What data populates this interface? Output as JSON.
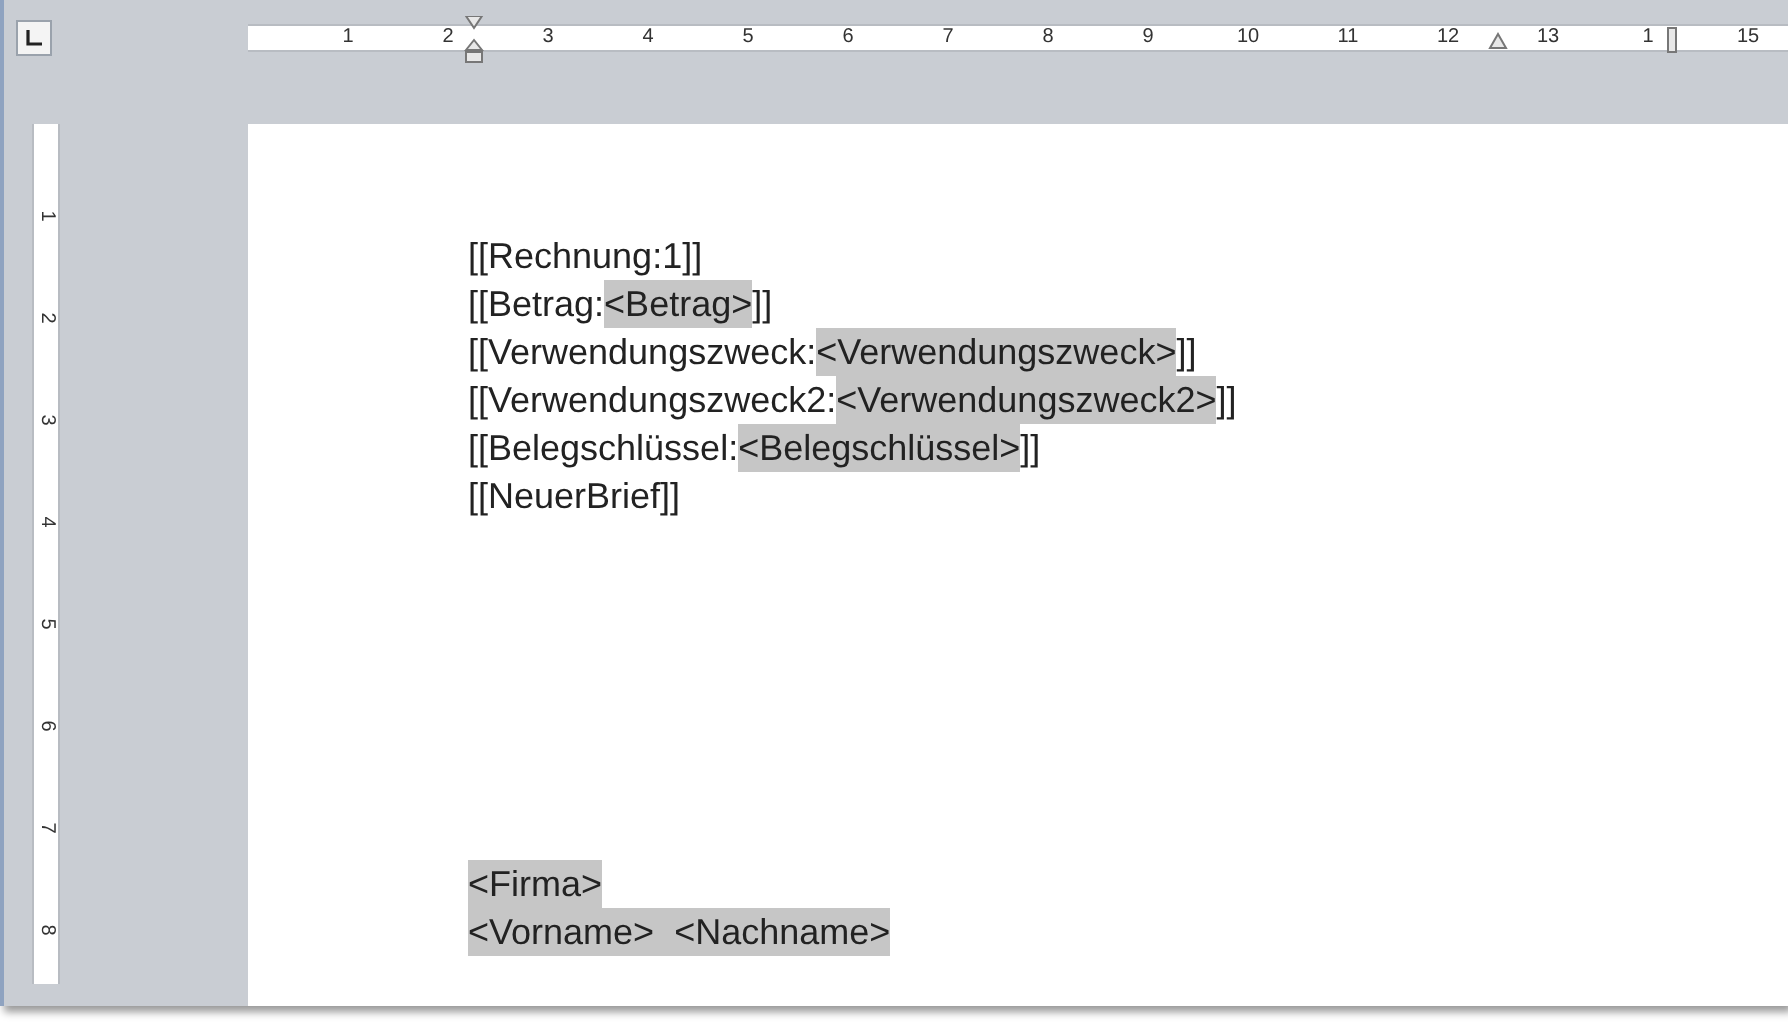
{
  "ruler": {
    "horizontal": [
      "1",
      "2",
      "3",
      "4",
      "5",
      "6",
      "7",
      "8",
      "9",
      "10",
      "11",
      "12",
      "13",
      "1",
      "15"
    ],
    "vertical": [
      "1",
      "2",
      "3",
      "4",
      "5",
      "6",
      "7",
      "8"
    ]
  },
  "document": {
    "header_lines": [
      {
        "segments": [
          {
            "text": "[[Rechnung:1]]",
            "field": false
          }
        ]
      },
      {
        "segments": [
          {
            "text": "[[Betrag:",
            "field": false
          },
          {
            "text": "<Betrag>",
            "field": true
          },
          {
            "text": "]]",
            "field": false
          }
        ]
      },
      {
        "segments": [
          {
            "text": "[[Verwendungszweck:",
            "field": false
          },
          {
            "text": "<Verwendungszweck>",
            "field": true
          },
          {
            "text": "]]",
            "field": false
          }
        ]
      },
      {
        "segments": [
          {
            "text": "[[Verwendungszweck2:",
            "field": false
          },
          {
            "text": "<Verwendungszweck2>",
            "field": true
          },
          {
            "text": "]]",
            "field": false
          }
        ]
      },
      {
        "segments": [
          {
            "text": "[[Belegschlüssel:",
            "field": false
          },
          {
            "text": "<Belegschlüssel>",
            "field": true
          },
          {
            "text": "]]",
            "field": false
          }
        ]
      },
      {
        "segments": [
          {
            "text": "[[NeuerBrief]]",
            "field": false
          }
        ]
      }
    ],
    "address_lines": [
      {
        "segments": [
          {
            "text": "<Firma>",
            "field": true
          }
        ]
      },
      {
        "segments": [
          {
            "text": "<Vorname>  <Nachname>",
            "field": true
          }
        ]
      }
    ]
  }
}
